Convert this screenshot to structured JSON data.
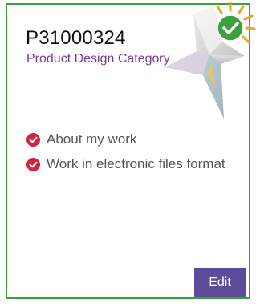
{
  "card": {
    "id_text": "P31000324",
    "category": "Product Design Category",
    "border_color": "#3aa03c",
    "category_color": "#7a3b97"
  },
  "status": {
    "icon": "check-badge-icon",
    "color": "#3ea03f",
    "ray_color": "#f0a21b"
  },
  "decor": {
    "icon": "star-icon"
  },
  "items": [
    {
      "label": "About my work",
      "icon": "checkmark-icon",
      "icon_color": "#d0243f"
    },
    {
      "label": "Work in electronic files format",
      "icon": "checkmark-icon",
      "icon_color": "#d0243f"
    }
  ],
  "actions": {
    "edit_label": "Edit",
    "edit_color": "#5b4d9a"
  }
}
